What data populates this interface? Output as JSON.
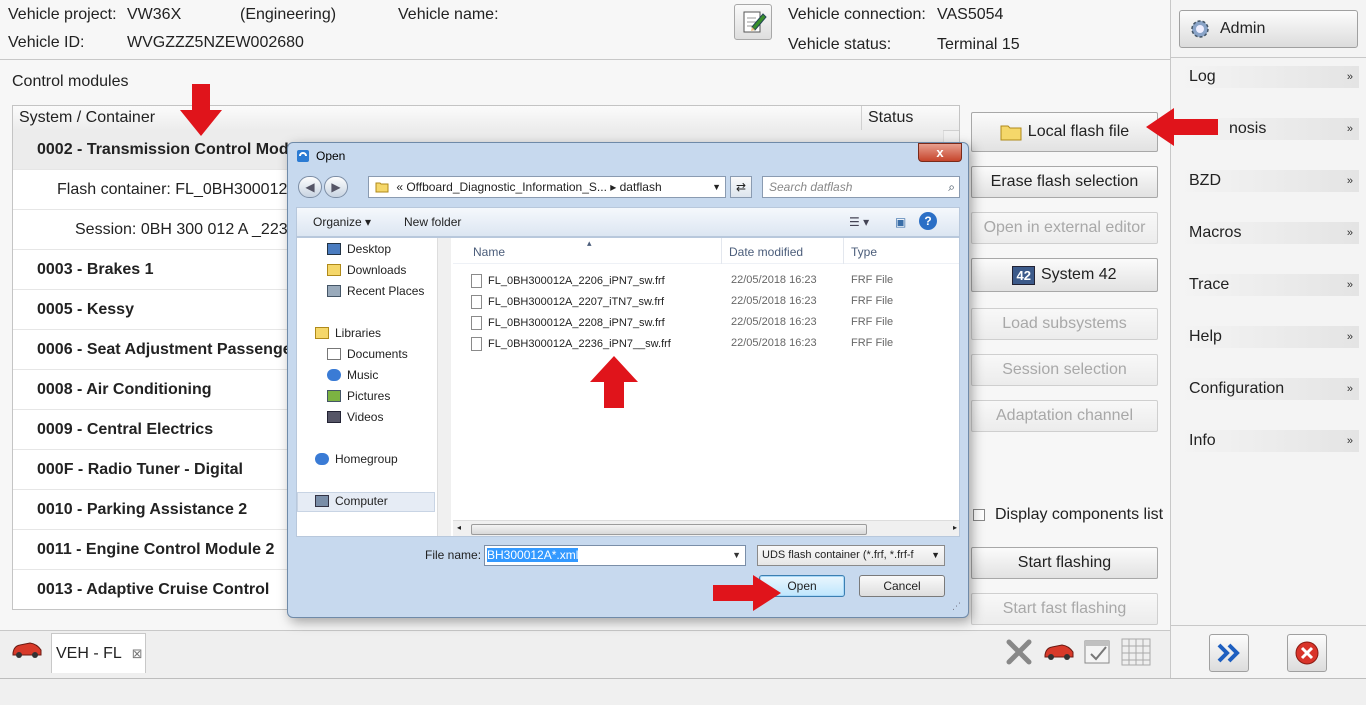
{
  "header": {
    "project_label": "Vehicle project:",
    "project_value": "VW36X",
    "project_mode": "(Engineering)",
    "name_label": "Vehicle name:",
    "name_value": "",
    "id_label": "Vehicle ID:",
    "id_value": "WVGZZZ5NZEW002680",
    "connection_label": "Vehicle connection:",
    "connection_value": "VAS5054",
    "status_label": "Vehicle status:",
    "status_value": "Terminal 15"
  },
  "sidebar": {
    "admin_label": "Admin",
    "items": [
      {
        "label": "Log"
      },
      {
        "label": "Diagnosis",
        "visible": "nosis"
      },
      {
        "label": "BZD"
      },
      {
        "label": "Macros"
      },
      {
        "label": "Trace"
      },
      {
        "label": "Help"
      },
      {
        "label": "Configuration"
      },
      {
        "label": "Info"
      }
    ]
  },
  "main": {
    "section_label": "Control modules",
    "col_system": "System / Container",
    "col_status": "Status",
    "rows": [
      {
        "text": "0002 - Transmission Control Mod",
        "kind": "bold",
        "selected": true
      },
      {
        "text": "Flash container: FL_0BH300012",
        "kind": "sub1"
      },
      {
        "text": "Session: 0BH 300 012 A _223",
        "kind": "sub2"
      },
      {
        "text": "0003 - Brakes 1",
        "kind": "bold"
      },
      {
        "text": "0005 - Kessy",
        "kind": "bold"
      },
      {
        "text": "0006 - Seat Adjustment Passenge",
        "kind": "bold"
      },
      {
        "text": "0008 - Air Conditioning",
        "kind": "bold"
      },
      {
        "text": "0009 - Central Electrics",
        "kind": "bold"
      },
      {
        "text": "000F - Radio Tuner - Digital",
        "kind": "bold"
      },
      {
        "text": "0010 - Parking Assistance 2",
        "kind": "bold"
      },
      {
        "text": "0011 - Engine Control Module 2",
        "kind": "bold"
      },
      {
        "text": "0013 - Adaptive Cruise Control",
        "kind": "bold"
      }
    ]
  },
  "actions": {
    "local_flash": "Local flash file",
    "erase_selection": "Erase flash selection",
    "open_external": "Open in external editor",
    "system42": "System 42",
    "system42_badge": "42",
    "load_subsystems": "Load subsystems",
    "session_selection": "Session selection",
    "adaptation_channel": "Adaptation channel",
    "display_components": "Display components list",
    "start_flashing": "Start flashing",
    "start_fast_flashing": "Start fast flashing"
  },
  "tabs": {
    "veh_fl": "VEH - FL",
    "close_glyph": "⊠"
  },
  "dialog": {
    "title": "Open",
    "close_glyph": "x",
    "address": "«  Offboard_Diagnostic_Information_S...  ▸  datflash",
    "search_placeholder": "Search datflash",
    "organize": "Organize ▾",
    "new_folder": "New folder",
    "nav": [
      {
        "label": "Desktop"
      },
      {
        "label": "Downloads"
      },
      {
        "label": "Recent Places"
      },
      {
        "label": "Libraries"
      },
      {
        "label": "Documents"
      },
      {
        "label": "Music"
      },
      {
        "label": "Pictures"
      },
      {
        "label": "Videos"
      },
      {
        "label": "Homegroup"
      },
      {
        "label": "Computer"
      }
    ],
    "col_name": "Name",
    "col_date": "Date modified",
    "col_type": "Type",
    "files": [
      {
        "name": "FL_0BH300012A_2206_iPN7_sw.frf",
        "date": "22/05/2018 16:23",
        "type": "FRF File"
      },
      {
        "name": "FL_0BH300012A_2207_iTN7_sw.frf",
        "date": "22/05/2018 16:23",
        "type": "FRF File"
      },
      {
        "name": "FL_0BH300012A_2208_iPN7_sw.frf",
        "date": "22/05/2018 16:23",
        "type": "FRF File"
      },
      {
        "name": "FL_0BH300012A_2236_iPN7__sw.frf",
        "date": "22/05/2018 16:23",
        "type": "FRF File"
      }
    ],
    "file_name_label": "File name:",
    "file_name_value": "BH300012A*.xml",
    "file_type_value": "UDS flash container (*.frf, *.frf-f",
    "open_label": "Open",
    "cancel_label": "Cancel"
  },
  "colors": {
    "arrow": "#e0141b",
    "dialog_frame": "#c7d9ee",
    "selection": "#3399ff"
  }
}
